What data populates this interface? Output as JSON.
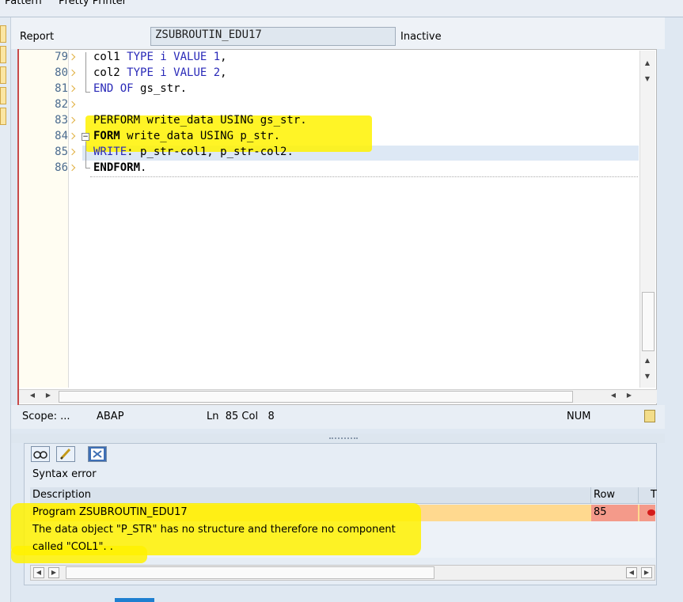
{
  "menu": {
    "items": [
      "Pattern",
      "Pretty Printer"
    ]
  },
  "header": {
    "type_label": "Report",
    "program_name": "ZSUBROUTIN_EDU17",
    "status": "Inactive"
  },
  "editor": {
    "lines": [
      {
        "num": "79",
        "text": [
          [
            "col1 ",
            ""
          ],
          [
            "TYPE i VALUE ",
            "kw"
          ],
          [
            "1",
            "num"
          ],
          [
            ",",
            ""
          ]
        ]
      },
      {
        "num": "80",
        "text": [
          [
            "col2 ",
            ""
          ],
          [
            "TYPE i VALUE ",
            "kw"
          ],
          [
            "2",
            "num"
          ],
          [
            ",",
            ""
          ]
        ]
      },
      {
        "num": "81",
        "text": [
          [
            "END OF ",
            "kw"
          ],
          [
            "gs_str.",
            ""
          ]
        ]
      },
      {
        "num": "82",
        "text": []
      },
      {
        "num": "83",
        "text": [
          [
            "PERFORM write_data USING gs_str.",
            ""
          ]
        ]
      },
      {
        "num": "84",
        "text": [
          [
            "FORM",
            "bold"
          ],
          [
            " write_data USING p_str.",
            ""
          ]
        ]
      },
      {
        "num": "85",
        "text": [
          [
            "WRITE",
            "kw"
          ],
          [
            ": p_str-col1, p_str-col2.",
            ""
          ]
        ]
      },
      {
        "num": "86",
        "text": [
          [
            "ENDFORM",
            "bold"
          ],
          [
            ".",
            ""
          ]
        ]
      }
    ]
  },
  "status_bar": {
    "scope": "Scope: ...",
    "language": "ABAP",
    "position": "Ln  85 Col   8",
    "num_mode": "NUM"
  },
  "error_panel": {
    "title": "Syntax error",
    "columns": {
      "description": "Description",
      "row": "Row",
      "type": "T"
    },
    "program_line": "Program ZSUBROUTIN_EDU17",
    "row_value": "85",
    "message_line1": "The data object \"P_STR\" has no structure and therefore no component",
    "message_line2": "called \"COL1\". ."
  }
}
